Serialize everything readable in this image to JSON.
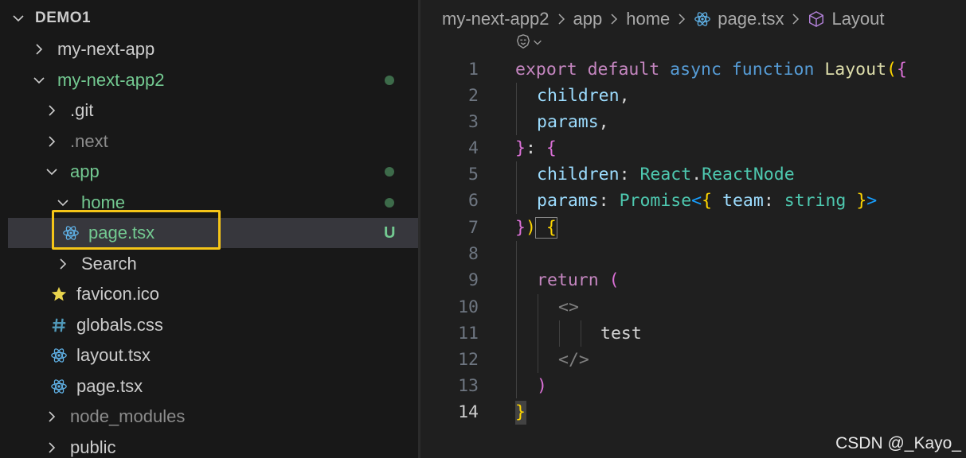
{
  "explorer": {
    "title": "DEMO1",
    "items": [
      {
        "label": "my-next-app"
      },
      {
        "label": "my-next-app2"
      },
      {
        "label": ".git"
      },
      {
        "label": ".next"
      },
      {
        "label": "app"
      },
      {
        "label": "home"
      },
      {
        "label": "page.tsx",
        "badge": "U"
      },
      {
        "label": "Search"
      },
      {
        "label": "favicon.ico"
      },
      {
        "label": "globals.css"
      },
      {
        "label": "layout.tsx"
      },
      {
        "label": "page.tsx"
      },
      {
        "label": "node_modules"
      },
      {
        "label": "public"
      }
    ]
  },
  "breadcrumb": [
    "my-next-app2",
    "app",
    "home",
    "page.tsx",
    "Layout"
  ],
  "editor": {
    "active_line": 14,
    "line_numbers": [
      "1",
      "2",
      "3",
      "4",
      "5",
      "6",
      "7",
      "8",
      "9",
      "10",
      "11",
      "12",
      "13",
      "14"
    ],
    "tokens": {
      "l1": [
        "export",
        " default",
        " async",
        " function",
        " Layout",
        "(",
        "{"
      ],
      "l2": [
        "children",
        ","
      ],
      "l3": [
        "params",
        ","
      ],
      "l4": [
        "}",
        ": ",
        "{"
      ],
      "l5": [
        "children",
        ": ",
        "React",
        ".",
        "ReactNode"
      ],
      "l6": [
        "params",
        ": ",
        "Promise",
        "<",
        "{",
        " team",
        ": ",
        "string",
        " }",
        ">"
      ],
      "l7": [
        "}",
        ")",
        " {"
      ],
      "l9": [
        "return",
        " ("
      ],
      "l10": [
        "<>"
      ],
      "l11": [
        "test"
      ],
      "l12": [
        "</>"
      ],
      "l13": [
        ")"
      ],
      "l14": [
        "}"
      ]
    }
  },
  "watermark": "CSDN @_Kayo_",
  "colors": {
    "sidebar_bg": "#181818",
    "editor_bg": "#1f1f1f",
    "git_untracked": "#73c991",
    "selection_box": "#f5c518"
  },
  "icons": [
    "chevron-right-icon",
    "chevron-down-icon",
    "react-icon",
    "star-icon",
    "hash-icon",
    "cube-icon",
    "copilot-icon"
  ]
}
